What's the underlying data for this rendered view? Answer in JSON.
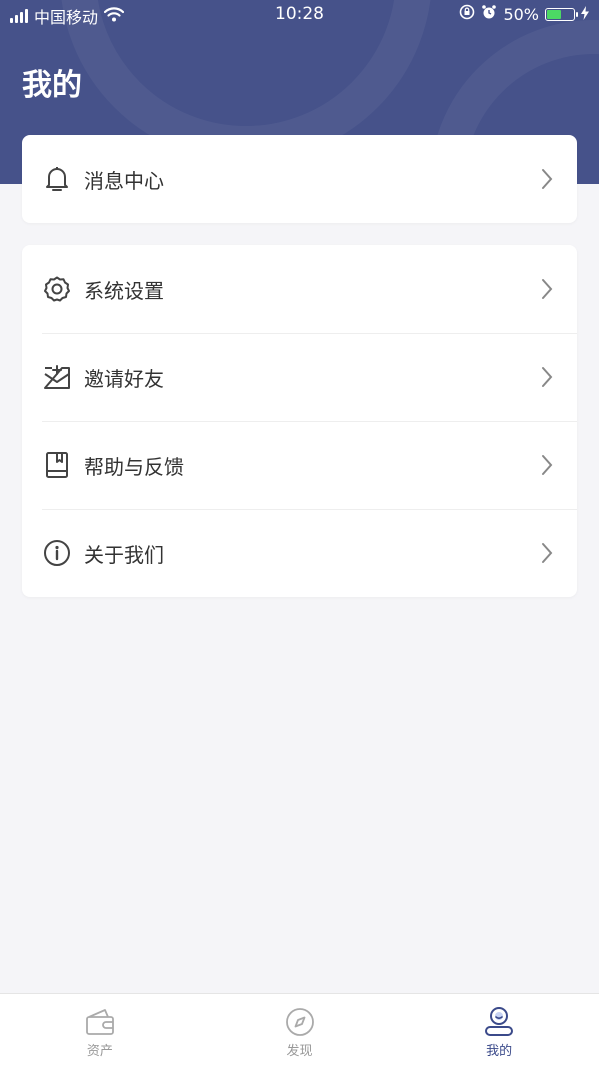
{
  "status_bar": {
    "carrier": "中国移动",
    "time": "10:28",
    "battery": "50%"
  },
  "page": {
    "title": "我的"
  },
  "menu_primary": [
    {
      "label": "消息中心",
      "icon": "bell-icon"
    }
  ],
  "menu_secondary": [
    {
      "label": "系统设置",
      "icon": "gear-icon"
    },
    {
      "label": "邀请好友",
      "icon": "invite-mail-icon"
    },
    {
      "label": "帮助与反馈",
      "icon": "book-icon"
    },
    {
      "label": "关于我们",
      "icon": "info-icon"
    }
  ],
  "tabbar": {
    "items": [
      {
        "label": "资产",
        "icon": "wallet-icon",
        "active": false
      },
      {
        "label": "发现",
        "icon": "compass-icon",
        "active": false
      },
      {
        "label": "我的",
        "icon": "profile-icon",
        "active": true
      }
    ]
  },
  "colors": {
    "header": "#46528a",
    "accent": "#3b4a8a",
    "background": "#f5f5f8"
  }
}
